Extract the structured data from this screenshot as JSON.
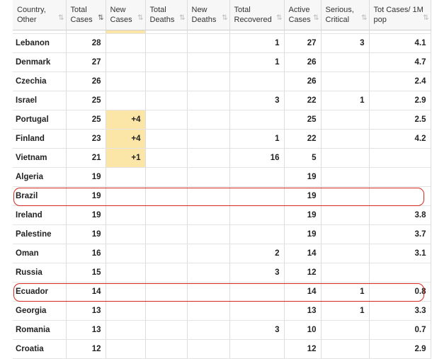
{
  "headers": [
    {
      "label": "Country, Other",
      "sorted": false
    },
    {
      "label": "Total Cases",
      "sorted": true
    },
    {
      "label": "New Cases",
      "sorted": false
    },
    {
      "label": "Total Deaths",
      "sorted": false
    },
    {
      "label": "New Deaths",
      "sorted": false
    },
    {
      "label": "Total Recovered",
      "sorted": false
    },
    {
      "label": "Active Cases",
      "sorted": false
    },
    {
      "label": "Serious, Critical",
      "sorted": false
    },
    {
      "label": "Tot Cases/ 1M pop",
      "sorted": false
    }
  ],
  "sort_icon": "⇅",
  "rows": [
    {
      "country": "Lebanon",
      "total_cases": "28",
      "new_cases": "",
      "total_deaths": "",
      "new_deaths": "",
      "total_recovered": "1",
      "active_cases": "27",
      "serious_critical": "3",
      "per_million": "4.1",
      "highlighted": false
    },
    {
      "country": "Denmark",
      "total_cases": "27",
      "new_cases": "",
      "total_deaths": "",
      "new_deaths": "",
      "total_recovered": "1",
      "active_cases": "26",
      "serious_critical": "",
      "per_million": "4.7",
      "highlighted": false
    },
    {
      "country": "Czechia",
      "total_cases": "26",
      "new_cases": "",
      "total_deaths": "",
      "new_deaths": "",
      "total_recovered": "",
      "active_cases": "26",
      "serious_critical": "",
      "per_million": "2.4",
      "highlighted": false
    },
    {
      "country": "Israel",
      "total_cases": "25",
      "new_cases": "",
      "total_deaths": "",
      "new_deaths": "",
      "total_recovered": "3",
      "active_cases": "22",
      "serious_critical": "1",
      "per_million": "2.9",
      "highlighted": false
    },
    {
      "country": "Portugal",
      "total_cases": "25",
      "new_cases": "+4",
      "total_deaths": "",
      "new_deaths": "",
      "total_recovered": "",
      "active_cases": "25",
      "serious_critical": "",
      "per_million": "2.5",
      "highlighted": false
    },
    {
      "country": "Finland",
      "total_cases": "23",
      "new_cases": "+4",
      "total_deaths": "",
      "new_deaths": "",
      "total_recovered": "1",
      "active_cases": "22",
      "serious_critical": "",
      "per_million": "4.2",
      "highlighted": false
    },
    {
      "country": "Vietnam",
      "total_cases": "21",
      "new_cases": "+1",
      "total_deaths": "",
      "new_deaths": "",
      "total_recovered": "16",
      "active_cases": "5",
      "serious_critical": "",
      "per_million": "",
      "highlighted": false
    },
    {
      "country": "Algeria",
      "total_cases": "19",
      "new_cases": "",
      "total_deaths": "",
      "new_deaths": "",
      "total_recovered": "",
      "active_cases": "19",
      "serious_critical": "",
      "per_million": "",
      "highlighted": false
    },
    {
      "country": "Brazil",
      "total_cases": "19",
      "new_cases": "",
      "total_deaths": "",
      "new_deaths": "",
      "total_recovered": "",
      "active_cases": "19",
      "serious_critical": "",
      "per_million": "",
      "highlighted": true
    },
    {
      "country": "Ireland",
      "total_cases": "19",
      "new_cases": "",
      "total_deaths": "",
      "new_deaths": "",
      "total_recovered": "",
      "active_cases": "19",
      "serious_critical": "",
      "per_million": "3.8",
      "highlighted": false
    },
    {
      "country": "Palestine",
      "total_cases": "19",
      "new_cases": "",
      "total_deaths": "",
      "new_deaths": "",
      "total_recovered": "",
      "active_cases": "19",
      "serious_critical": "",
      "per_million": "3.7",
      "highlighted": false
    },
    {
      "country": "Oman",
      "total_cases": "16",
      "new_cases": "",
      "total_deaths": "",
      "new_deaths": "",
      "total_recovered": "2",
      "active_cases": "14",
      "serious_critical": "",
      "per_million": "3.1",
      "highlighted": false
    },
    {
      "country": "Russia",
      "total_cases": "15",
      "new_cases": "",
      "total_deaths": "",
      "new_deaths": "",
      "total_recovered": "3",
      "active_cases": "12",
      "serious_critical": "",
      "per_million": "",
      "highlighted": false
    },
    {
      "country": "Ecuador",
      "total_cases": "14",
      "new_cases": "",
      "total_deaths": "",
      "new_deaths": "",
      "total_recovered": "",
      "active_cases": "14",
      "serious_critical": "1",
      "per_million": "0.8",
      "highlighted": true
    },
    {
      "country": "Georgia",
      "total_cases": "13",
      "new_cases": "",
      "total_deaths": "",
      "new_deaths": "",
      "total_recovered": "",
      "active_cases": "13",
      "serious_critical": "1",
      "per_million": "3.3",
      "highlighted": false
    },
    {
      "country": "Romania",
      "total_cases": "13",
      "new_cases": "",
      "total_deaths": "",
      "new_deaths": "",
      "total_recovered": "3",
      "active_cases": "10",
      "serious_critical": "",
      "per_million": "0.7",
      "highlighted": false
    },
    {
      "country": "Croatia",
      "total_cases": "12",
      "new_cases": "",
      "total_deaths": "",
      "new_deaths": "",
      "total_recovered": "",
      "active_cases": "12",
      "serious_critical": "",
      "per_million": "2.9",
      "highlighted": false
    }
  ],
  "colors": {
    "new_cases_highlight": "#fbe6a8",
    "annotation_box": "#d8281e"
  }
}
